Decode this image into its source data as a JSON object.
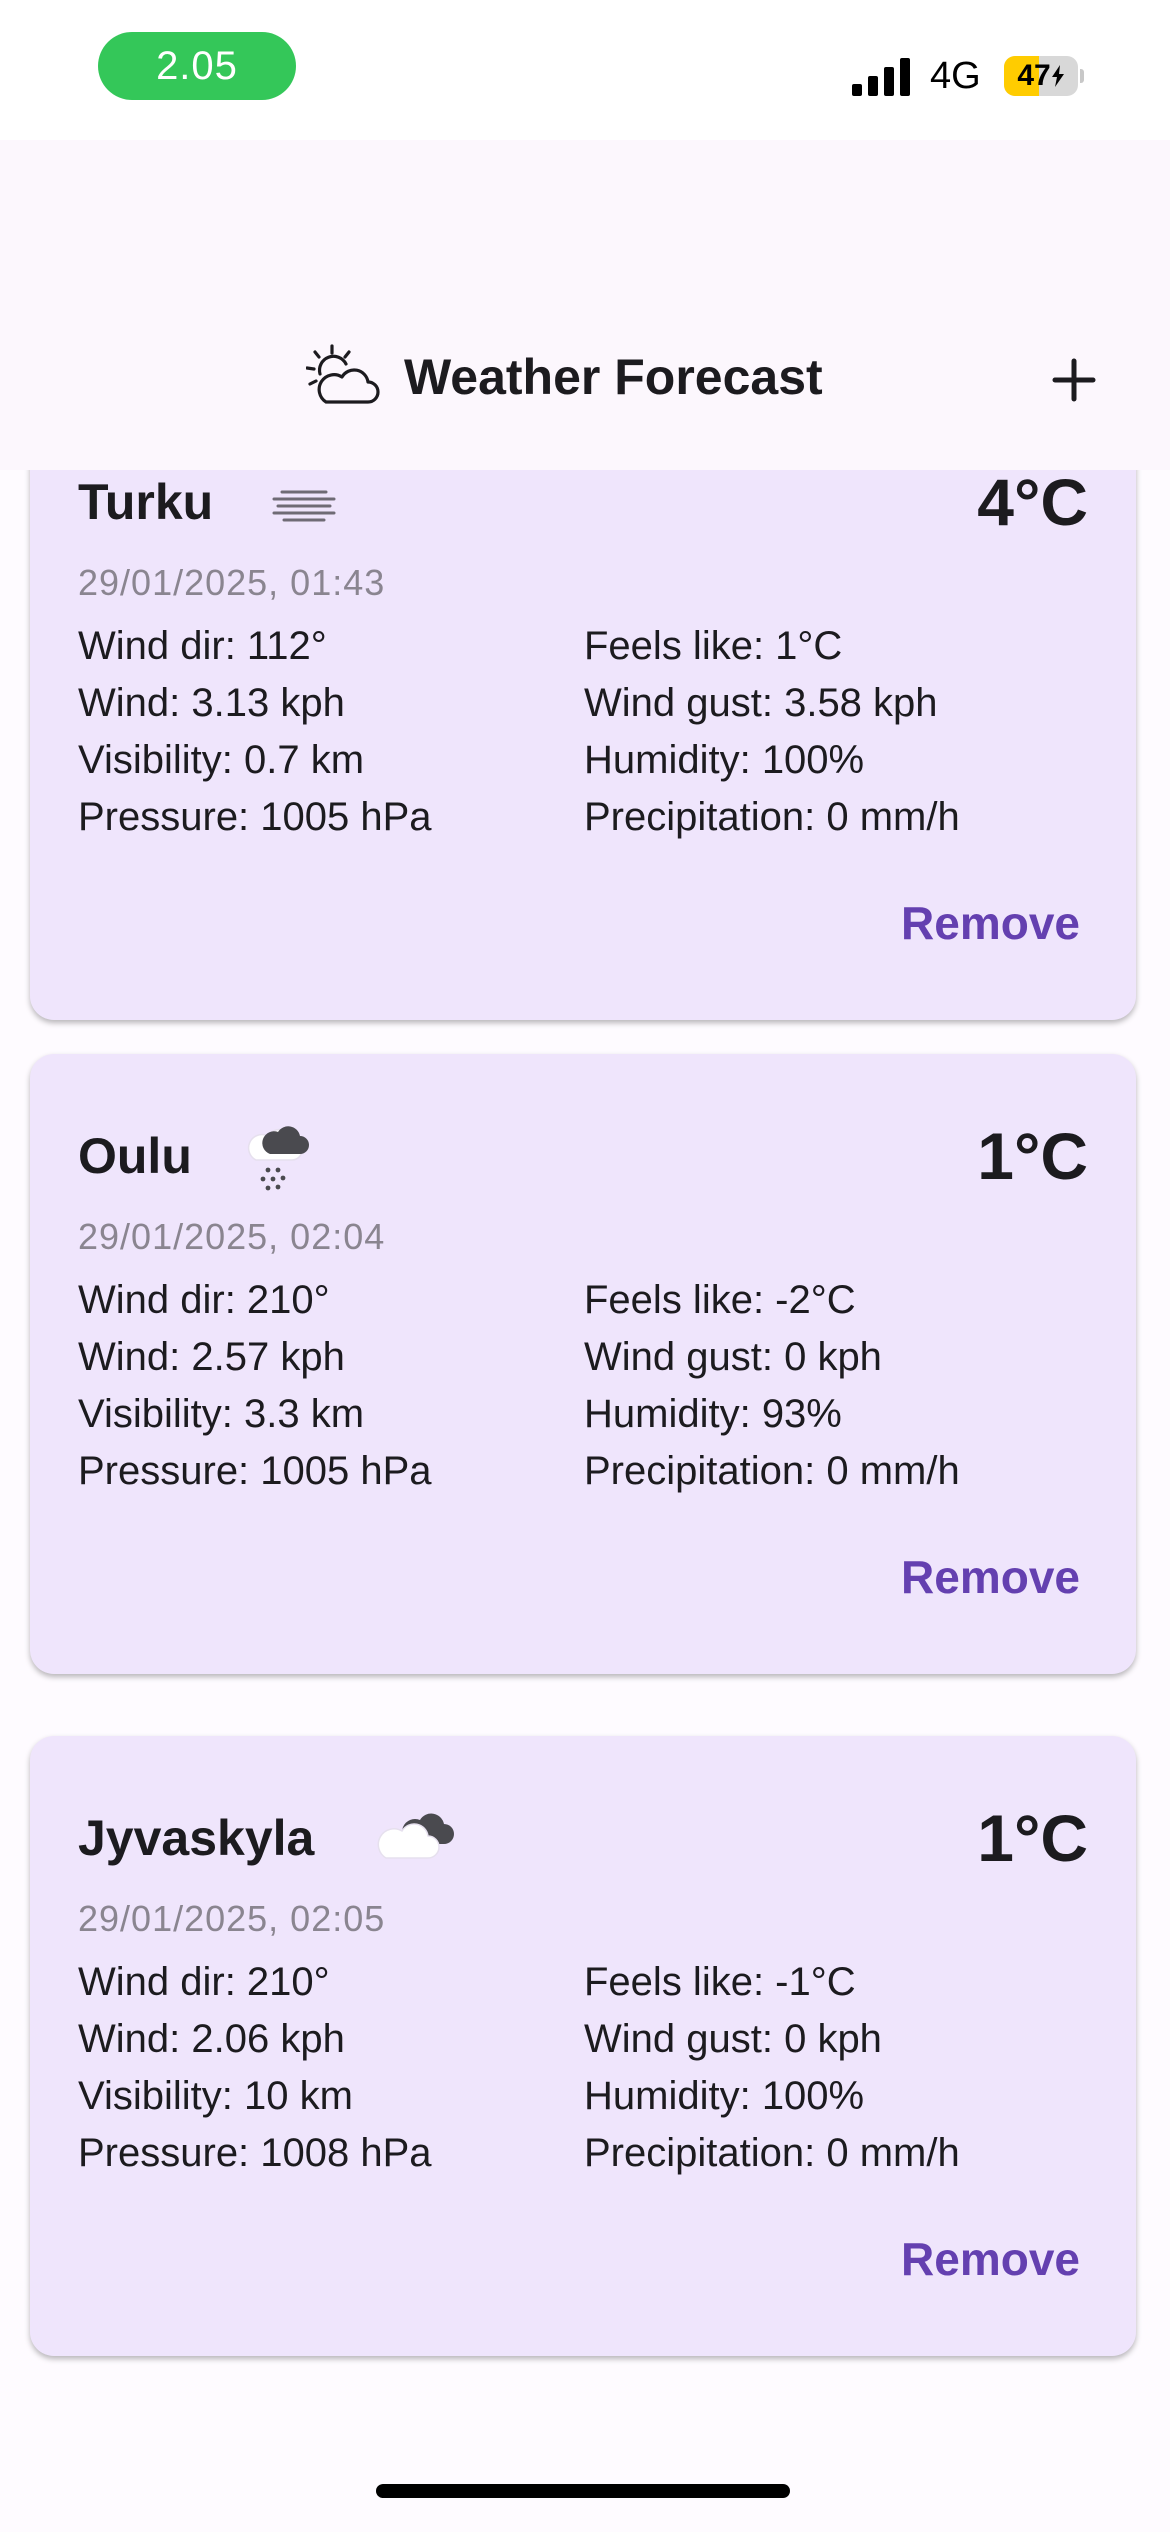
{
  "status_bar": {
    "time": "2.05",
    "network": "4G",
    "battery_level": "47",
    "battery_fraction": 0.47,
    "pill_color": "#34C759",
    "battery_color": "#FFCC00"
  },
  "app_bar": {
    "title": "Weather Forecast",
    "icon": "partly-cloudy-sun-icon",
    "action_icon": "plus-icon"
  },
  "cards": [
    {
      "city": "Turku",
      "condition_icon": "fog-icon",
      "temperature": "4°C",
      "timestamp": "29/01/2025, 01:43",
      "wind_dir": "Wind dir: 112°",
      "wind": "Wind: 3.13 kph",
      "visibility": "Visibility: 0.7 km",
      "pressure": "Pressure: 1005 hPa",
      "feels_like": "Feels like: 1°C",
      "wind_gust": "Wind gust: 3.58 kph",
      "humidity": "Humidity: 100%",
      "precipitation": "Precipitation: 0 mm/h",
      "remove_label": "Remove"
    },
    {
      "city": "Oulu",
      "condition_icon": "snow-cloud-icon",
      "temperature": "1°C",
      "timestamp": "29/01/2025, 02:04",
      "wind_dir": "Wind dir: 210°",
      "wind": "Wind: 2.57 kph",
      "visibility": "Visibility: 3.3 km",
      "pressure": "Pressure: 1005 hPa",
      "feels_like": "Feels like: -2°C",
      "wind_gust": "Wind gust: 0 kph",
      "humidity": "Humidity: 93%",
      "precipitation": "Precipitation: 0 mm/h",
      "remove_label": "Remove"
    },
    {
      "city": "Jyvaskyla",
      "condition_icon": "overcast-cloud-icon",
      "temperature": "1°C",
      "timestamp": "29/01/2025, 02:05",
      "wind_dir": "Wind dir: 210°",
      "wind": "Wind: 2.06 kph",
      "visibility": "Visibility: 10 km",
      "pressure": "Pressure: 1008 hPa",
      "feels_like": "Feels like: -1°C",
      "wind_gust": "Wind gust: 0 kph",
      "humidity": "Humidity: 100%",
      "precipitation": "Precipitation: 0 mm/h",
      "remove_label": "Remove"
    }
  ],
  "colors": {
    "card_background": "#EFE5FC",
    "app_bar_background": "#FCF7FD",
    "accent": "#6440B0",
    "timestamp_text": "#8A8590"
  }
}
